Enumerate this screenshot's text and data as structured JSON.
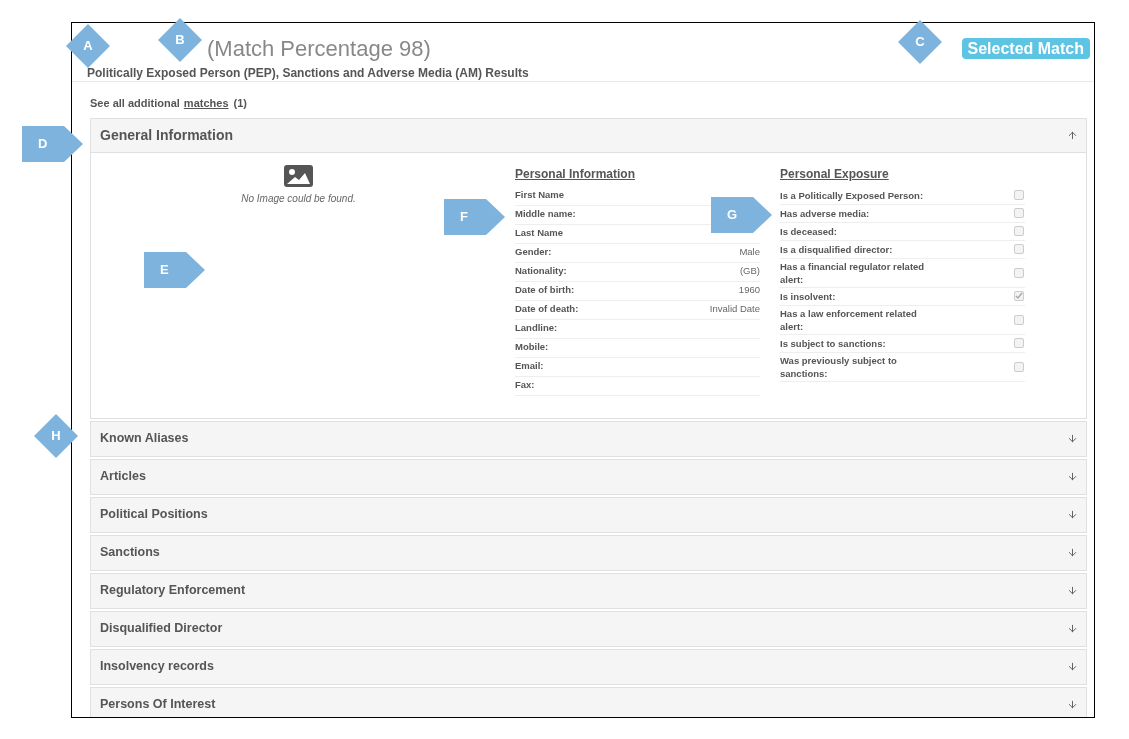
{
  "header": {
    "title": "(Match Percentage 98)",
    "subtitle": "Politically Exposed Person (PEP), Sanctions and Adverse Media (AM) Results",
    "badge": "Selected Match"
  },
  "additional_matches": {
    "text": "See all additional",
    "link": "matches",
    "count": "(1)"
  },
  "sections": [
    {
      "title": "General Information",
      "expanded": true
    },
    {
      "title": "Known Aliases",
      "expanded": false
    },
    {
      "title": "Articles",
      "expanded": false
    },
    {
      "title": "Political Positions",
      "expanded": false
    },
    {
      "title": "Sanctions",
      "expanded": false
    },
    {
      "title": "Regulatory Enforcement",
      "expanded": false
    },
    {
      "title": "Disqualified Director",
      "expanded": false
    },
    {
      "title": "Insolvency records",
      "expanded": false
    },
    {
      "title": "Persons Of Interest",
      "expanded": false
    }
  ],
  "general_information": {
    "image_note": "No Image could be found.",
    "personal_information": {
      "heading": "Personal Information",
      "rows": [
        {
          "label": "First Name"
        },
        {
          "label": "Middle name:"
        },
        {
          "label": "Last Name"
        },
        {
          "label": "Gender:",
          "value": "Male"
        },
        {
          "label": "Nationality:",
          "value": "(GB)"
        },
        {
          "label": "Date of birth:",
          "value": "1960"
        },
        {
          "label": "Date of death:",
          "value": "Invalid Date"
        },
        {
          "label": "Landline:"
        },
        {
          "label": "Mobile:"
        },
        {
          "label": "Email:"
        },
        {
          "label": "Fax:"
        }
      ]
    },
    "personal_exposure": {
      "heading": "Personal Exposure",
      "rows": [
        {
          "label": "Is a Politically Exposed Person:",
          "checked": false
        },
        {
          "label": "Has adverse media:",
          "checked": false
        },
        {
          "label": "Is deceased:",
          "checked": false
        },
        {
          "label": "Is a disqualified director:",
          "checked": false
        },
        {
          "label": "Has a financial regulator related alert:",
          "checked": false
        },
        {
          "label": "Is insolvent:",
          "checked": true
        },
        {
          "label": "Has a law enforcement related alert:",
          "checked": false
        },
        {
          "label": "Is subject to sanctions:",
          "checked": false
        },
        {
          "label": "Was previously subject to sanctions:",
          "checked": false
        }
      ]
    }
  },
  "callouts": [
    {
      "label": "A",
      "kind": "diamond"
    },
    {
      "label": "B",
      "kind": "diamond"
    },
    {
      "label": "C",
      "kind": "diamond"
    },
    {
      "label": "D",
      "kind": "arrow"
    },
    {
      "label": "E",
      "kind": "arrow"
    },
    {
      "label": "F",
      "kind": "arrow"
    },
    {
      "label": "G",
      "kind": "arrow"
    },
    {
      "label": "H",
      "kind": "diamond"
    }
  ]
}
